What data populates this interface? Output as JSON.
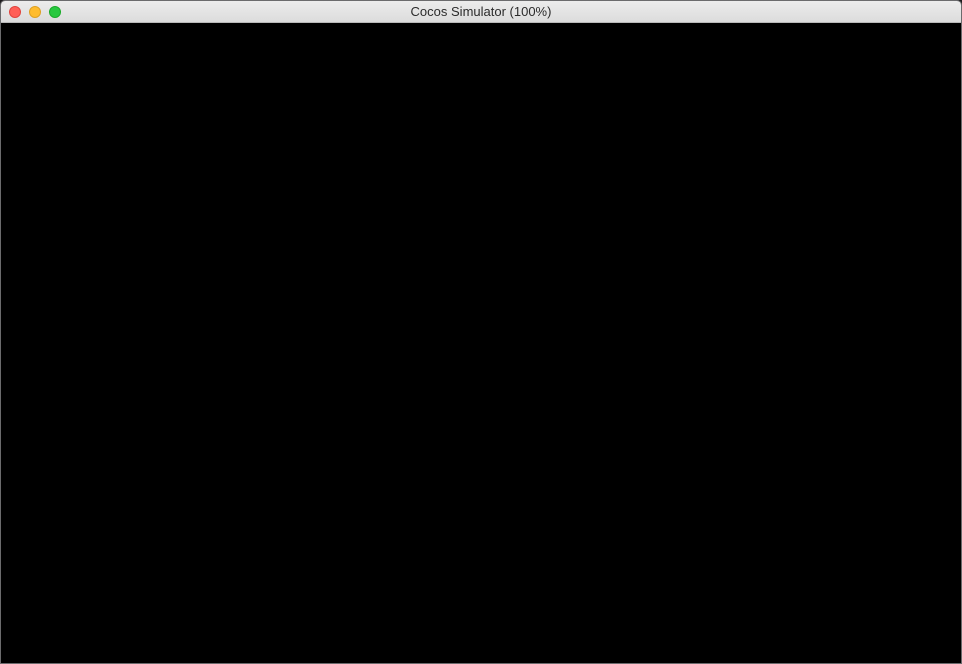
{
  "window": {
    "title": "Cocos Simulator (100%)",
    "buttons": {
      "close": "close-icon",
      "minimize": "minimize-icon",
      "zoom": "zoom-icon"
    },
    "colors": {
      "close": "#ff5f57",
      "minimize": "#febc2e",
      "zoom": "#28c840",
      "canvas": "#000000"
    }
  }
}
